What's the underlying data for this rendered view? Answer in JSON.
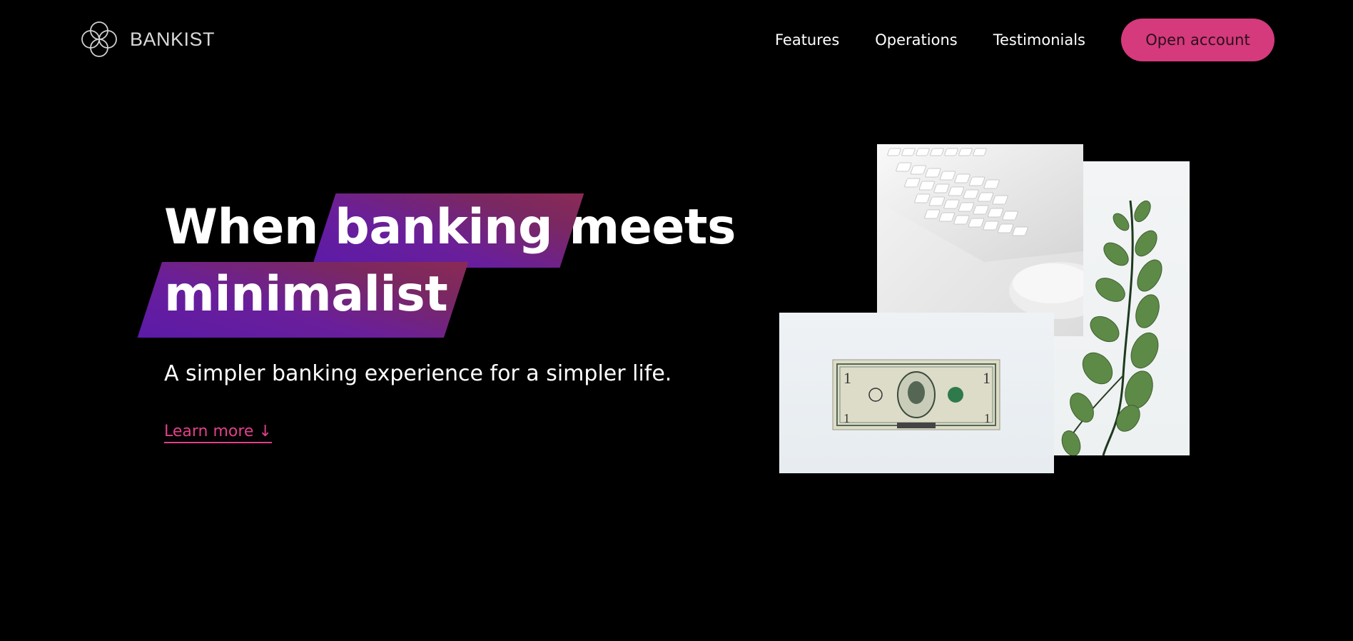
{
  "brand": {
    "name": "BANKIST",
    "logo_icon": "interlocking-circles-icon"
  },
  "nav": {
    "links": [
      {
        "label": "Features"
      },
      {
        "label": "Operations"
      },
      {
        "label": "Testimonials"
      }
    ],
    "cta": "Open account"
  },
  "hero": {
    "title_word_1": "When",
    "title_highlight_1": "banking",
    "title_word_2": "meets",
    "title_highlight_2": "minimalist",
    "subtitle": "A simpler banking experience for a simpler life.",
    "learn_more": "Learn more ↓"
  },
  "images": {
    "keyboard_icon": "keyboard-mouse-photo",
    "plant_icon": "eucalyptus-plant-photo",
    "dollar_icon": "dollar-bill-photo"
  },
  "colors": {
    "accent": "#d43a7c",
    "link": "#e0408a",
    "highlight_start": "#5b1aa8",
    "highlight_end": "#8a2a55",
    "background": "#000000"
  }
}
